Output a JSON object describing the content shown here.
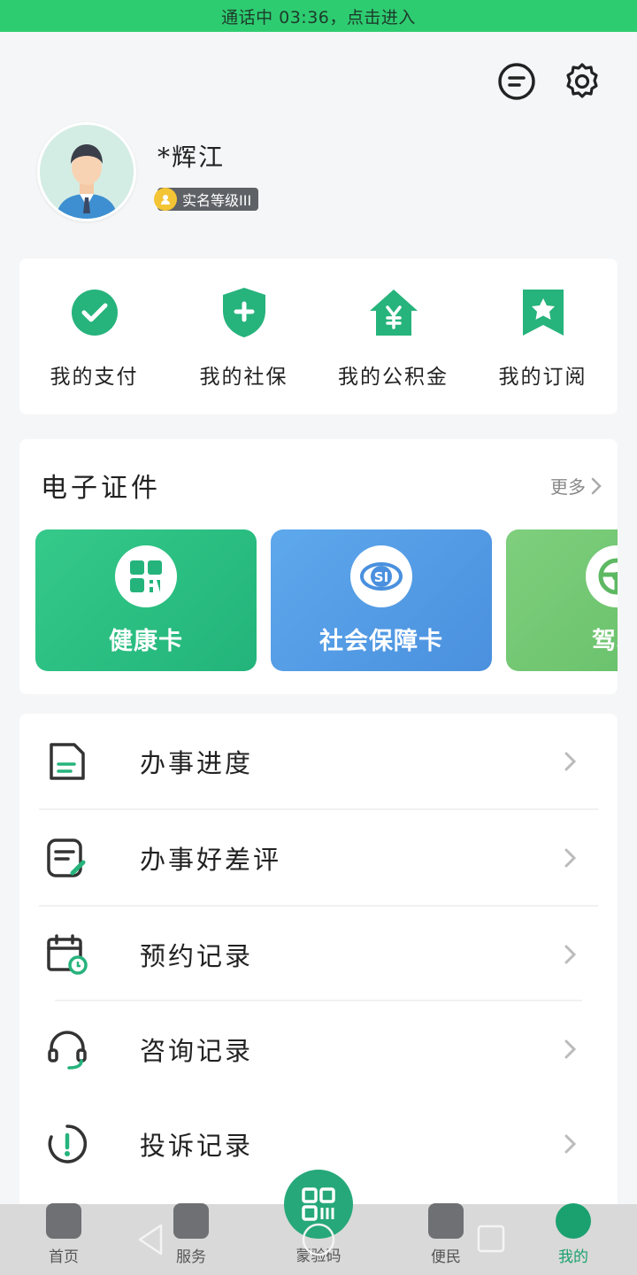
{
  "call_bar": {
    "text": "通话中   03:36，点击进入"
  },
  "top_icons": {
    "message": "message-icon",
    "settings": "gear-icon"
  },
  "profile": {
    "name": "*辉江",
    "level": "实名等级III"
  },
  "quick": [
    {
      "label": "我的支付",
      "icon": "check-circle-icon"
    },
    {
      "label": "我的社保",
      "icon": "shield-plus-icon"
    },
    {
      "label": "我的公积金",
      "icon": "house-yen-icon"
    },
    {
      "label": "我的订阅",
      "icon": "bookmark-star-icon"
    }
  ],
  "certs": {
    "title": "电子证件",
    "more": "更多",
    "items": [
      {
        "label": "健康卡",
        "icon": "qr-code-icon"
      },
      {
        "label": "社会保障卡",
        "icon": "social-security-icon"
      },
      {
        "label": "驾驶",
        "icon": "steering-wheel-icon"
      }
    ]
  },
  "records": [
    {
      "label": "办事进度",
      "icon": "document-icon"
    },
    {
      "label": "办事好差评",
      "icon": "edit-note-icon"
    },
    {
      "label": "预约记录",
      "icon": "calendar-clock-icon"
    },
    {
      "label": "咨询记录",
      "icon": "headset-icon"
    },
    {
      "label": "投诉记录",
      "icon": "alert-circle-icon"
    }
  ],
  "tabbar": {
    "items": [
      {
        "label": "首页"
      },
      {
        "label": "服务"
      },
      {
        "label": "便民"
      },
      {
        "label": "我的"
      }
    ],
    "center": {
      "label": "蒙验码"
    }
  },
  "colors": {
    "accent": "#26b37c",
    "call_bar": "#2ecc71",
    "cert_green": "#2bbd82",
    "cert_blue": "#4f96e2"
  }
}
